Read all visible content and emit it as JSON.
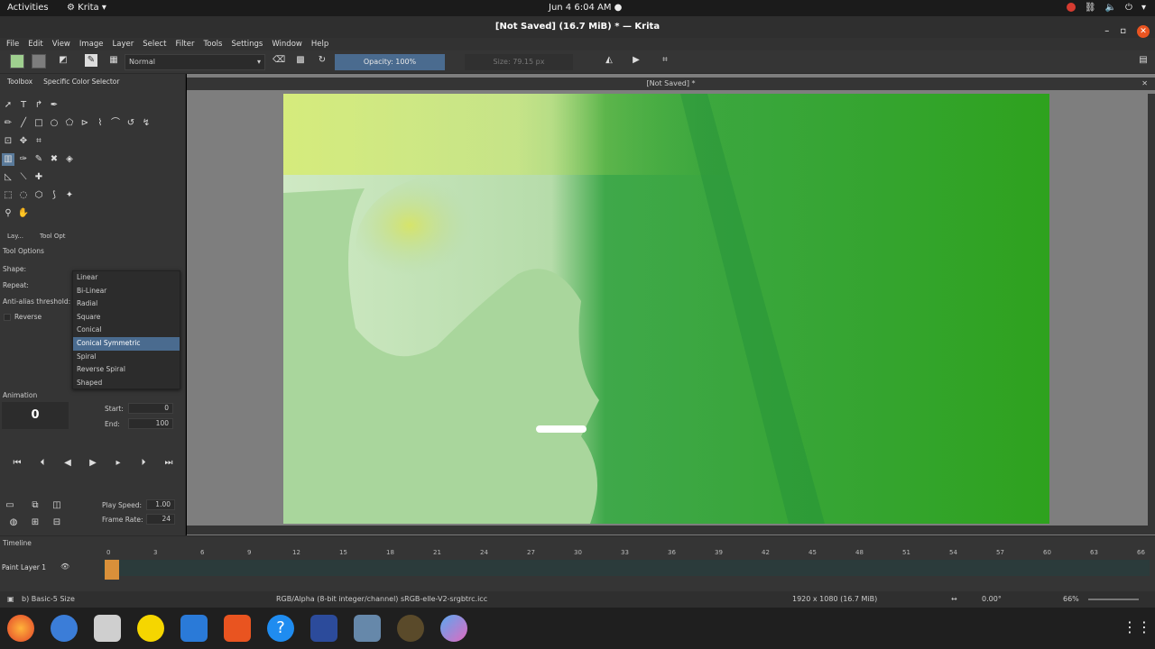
{
  "topbar": {
    "activities": "Activities",
    "app_name": "Krita",
    "clock": "Jun 4  6:04 AM"
  },
  "window": {
    "title": "[Not Saved]  (16.7 MiB)  * — Krita"
  },
  "menu": [
    "File",
    "Edit",
    "View",
    "Image",
    "Layer",
    "Select",
    "Filter",
    "Tools",
    "Settings",
    "Window",
    "Help"
  ],
  "toolbar": {
    "blend_mode": "Normal",
    "opacity": "Opacity: 100%",
    "size_label": "Size:",
    "size_value": "79.15 px"
  },
  "dockers": {
    "toolbox_tab": "Toolbox",
    "color_tab": "Specific Color Selector"
  },
  "tool_options": {
    "tab_layers": "Lay...",
    "tab_tool_options": "Tool Opt",
    "title": "Tool Options",
    "shape_label": "Shape:",
    "repeat_label": "Repeat:",
    "antialias_label": "Anti-alias threshold:",
    "reverse_label": "Reverse"
  },
  "gradient_dropdown": {
    "items": [
      "Linear",
      "Bi-Linear",
      "Radial",
      "Square",
      "Conical",
      "Conical Symmetric",
      "Spiral",
      "Reverse Spiral",
      "Shaped"
    ],
    "selected": "Conical Symmetric"
  },
  "animation": {
    "title": "Animation",
    "frame": "0",
    "start_label": "Start:",
    "start_value": "0",
    "end_label": "End:",
    "end_value": "100",
    "play_speed_label": "Play Speed:",
    "play_speed_value": "1.00",
    "frame_rate_label": "Frame Rate:",
    "frame_rate_value": "24"
  },
  "document": {
    "tab_title": "[Not Saved]  *"
  },
  "timeline": {
    "title": "Timeline",
    "layer_name": "Paint Layer 1",
    "ruler": [
      "0",
      "3",
      "6",
      "9",
      "12",
      "15",
      "18",
      "21",
      "24",
      "27",
      "30",
      "33",
      "36",
      "39",
      "42",
      "45",
      "48",
      "51",
      "54",
      "57",
      "60",
      "63",
      "66"
    ]
  },
  "status": {
    "brush": "b) Basic-5 Size",
    "color_space": "RGB/Alpha (8-bit integer/channel)  sRGB-elle-V2-srgbtrc.icc",
    "dimensions": "1920 x 1080 (16.7 MiB)",
    "rotation": "0.00°",
    "zoom": "66%"
  },
  "colors": {
    "accent": "#4a6b8f",
    "canvas_green": "#2fa21f",
    "canvas_light": "#a8d69b"
  }
}
